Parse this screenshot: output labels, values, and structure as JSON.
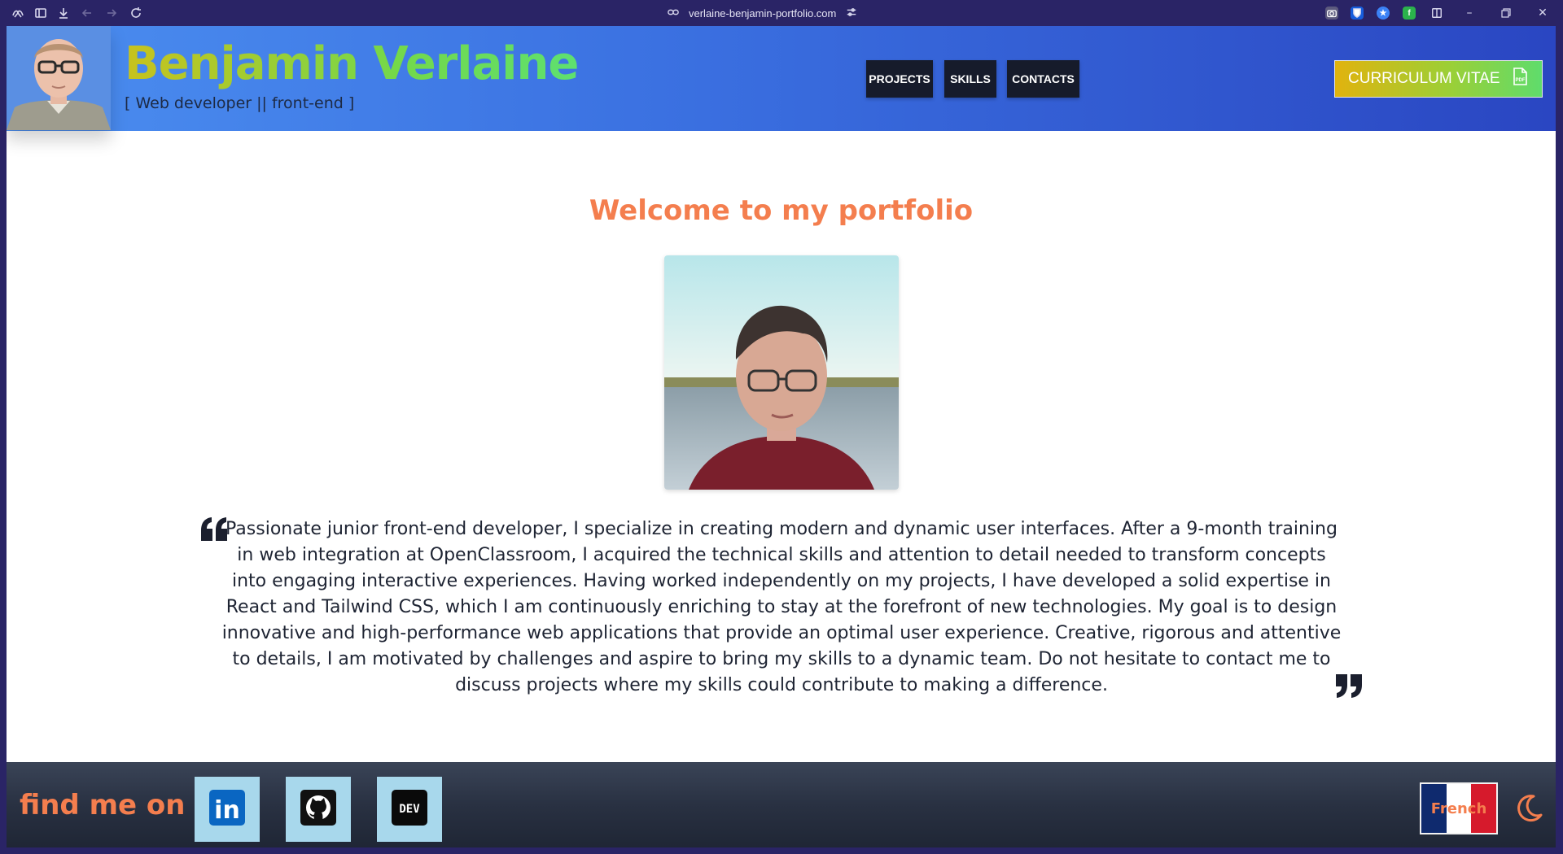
{
  "browser": {
    "url": "verlaine-benjamin-portfolio.com"
  },
  "header": {
    "name": "Benjamin Verlaine",
    "role": "[ Web developer || front-end ]",
    "nav": {
      "projects": "PROJECTS",
      "skills": "SKILLS",
      "contacts": "CONTACTS"
    },
    "cv_label": "CURRICULUM VITAE",
    "cv_icon_text": "PDF"
  },
  "main": {
    "welcome": "Welcome to my portfolio",
    "bio": "Passionate junior front-end developer, I specialize in creating modern and dynamic user interfaces. After a 9-month training in web integration at OpenClassroom, I acquired the technical skills and attention to detail needed to transform concepts into engaging interactive experiences. Having worked independently on my projects, I have developed a solid expertise in React and Tailwind CSS, which I am continuously enriching to stay at the forefront of new technologies. My goal is to design innovative and high-performance web applications that provide an optimal user experience. Creative, rigorous and attentive to details, I am motivated by challenges and aspire to bring my skills to a dynamic team. Do not hesitate to contact me to discuss projects where my skills could contribute to making a difference."
  },
  "footer": {
    "find_label": "find me on :",
    "socials": {
      "linkedin": "in",
      "devto": "DEV"
    },
    "language": "French"
  },
  "colors": {
    "accent": "#f47e4e",
    "nav_bg": "#161b2b",
    "header_start": "#4b8ef0",
    "header_end": "#2a46c2",
    "social_bg": "#a8d8ec"
  },
  "icons": [
    "extensions-icon",
    "sidebar-icon",
    "download-icon",
    "back-icon",
    "forward-icon",
    "reload-icon",
    "link-icon",
    "site-settings-icon",
    "camera-icon",
    "bitwarden-icon",
    "star-icon",
    "feedly-icon",
    "split-view-icon",
    "minimize-icon",
    "restore-icon",
    "close-icon",
    "pdf-icon",
    "quote-open-icon",
    "quote-close-icon",
    "linkedin-icon",
    "github-icon",
    "devto-icon",
    "moon-icon"
  ]
}
